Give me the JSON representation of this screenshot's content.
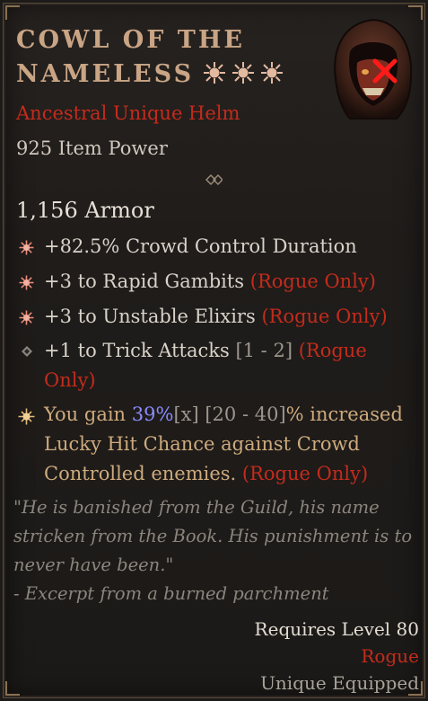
{
  "item": {
    "name_line1": "Cowl of the",
    "name_line2": "Nameless",
    "quality": "Ancestral Unique Helm",
    "item_power": "925 Item Power",
    "armor": "1,156 Armor",
    "icon": "hooded-helm-icon"
  },
  "affixes": [
    {
      "bullet": "starburst-bullet-icon",
      "text": "+82.5% Crowd Control Duration"
    },
    {
      "bullet": "starburst-bullet-icon",
      "text": "+3 to Rapid Gambits ",
      "class_req": "(Rogue Only)"
    },
    {
      "bullet": "starburst-bullet-icon",
      "text": "+3 to Unstable Elixirs ",
      "class_req": "(Rogue Only)"
    },
    {
      "bullet": "diamond-bullet-icon",
      "text": "+1 to Trick Attacks ",
      "range": "[1 - 2]",
      "class_req": "(Rogue",
      "class_req2": "Only)"
    }
  ],
  "unique_affix": {
    "bullet": "sun-bullet-icon",
    "prefix": "You gain ",
    "roll": "39%",
    "roll_mult": "[x]",
    "range": " [20 - 40]",
    "suffix": "% increased",
    "line2": "Lucky Hit Chance against Crowd",
    "line3": "Controlled enemies. ",
    "class_req": "(Rogue Only)"
  },
  "flavor": {
    "line1": "\"He is banished from the Guild, his name",
    "line2": "stricken from the Book. His punishment is to",
    "line3": "never have been.\"",
    "line4": "- Excerpt from a burned parchment"
  },
  "requirements": {
    "level": "Requires Level 80",
    "class": "Rogue",
    "equip": "Unique Equipped"
  },
  "colors": {
    "title": "#c9a585",
    "quality": "#c42b1c",
    "rogue_only": "#c42b1c",
    "roll": "#8a8cff",
    "unique_affix": "#cdaa7d"
  }
}
